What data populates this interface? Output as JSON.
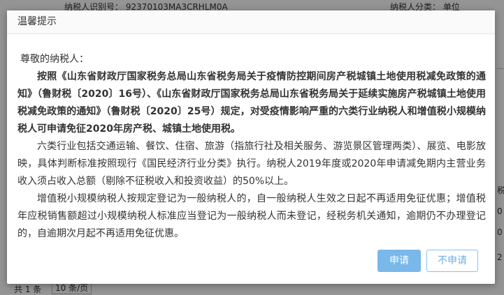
{
  "background": {
    "top_left_text": "纳税人识别号：  92370103MA3CRHLM0A",
    "top_right_text": "纳税人分类：  单位",
    "footer_total": "共 1 条",
    "footer_pagesize": "10 条/页",
    "right_fragments": [
      "",
      "税",
      "0",
      "0",
      "2"
    ]
  },
  "dialog": {
    "title": "温馨提示",
    "greeting": "尊敬的纳税人：",
    "paragraph1": "按照《山东省财政厅国家税务总局山东省税务局关于疫情防控期间房产税城镇土地使用税减免政策的通知》（鲁财税〔2020〕16号）、《山东省财政厅国家税务总局山东省税务局关于延续实施房产税城镇土地使用税减免政策的通知》（鲁财税〔2020〕25号）规定，对受疫情影响严重的六类行业纳税人和增值税小规模纳税人可申请免征2020年房产税、城镇土地使用税。",
    "paragraph2": "六类行业包括交通运输、餐饮、住宿、旅游（指旅行社及相关服务、游览景区管理两类）、展览、电影放映，具体判断标准按照现行《国民经济行业分类》执行。纳税人2019年度或2020年申请减免期内主营业务收入须占收入总额（剔除不征税收入和投资收益）的50%以上。",
    "paragraph3": "增值税小规模纳税人按规定登记为一般纳税人的，自一般纳税人生效之日起不再适用免征优惠；增值税年应税销售额超过小规模纳税人标准应当登记为一般纳税人而未登记，经税务机关通知，逾期仍不办理登记的，自逾期次月起不再适用免征优惠。",
    "apply_label": "申请",
    "decline_label": "不申请"
  },
  "colors": {
    "overlay": "#9a9a9a",
    "apply_button": "#79b8e9",
    "decline_text": "#6fb0e4"
  }
}
